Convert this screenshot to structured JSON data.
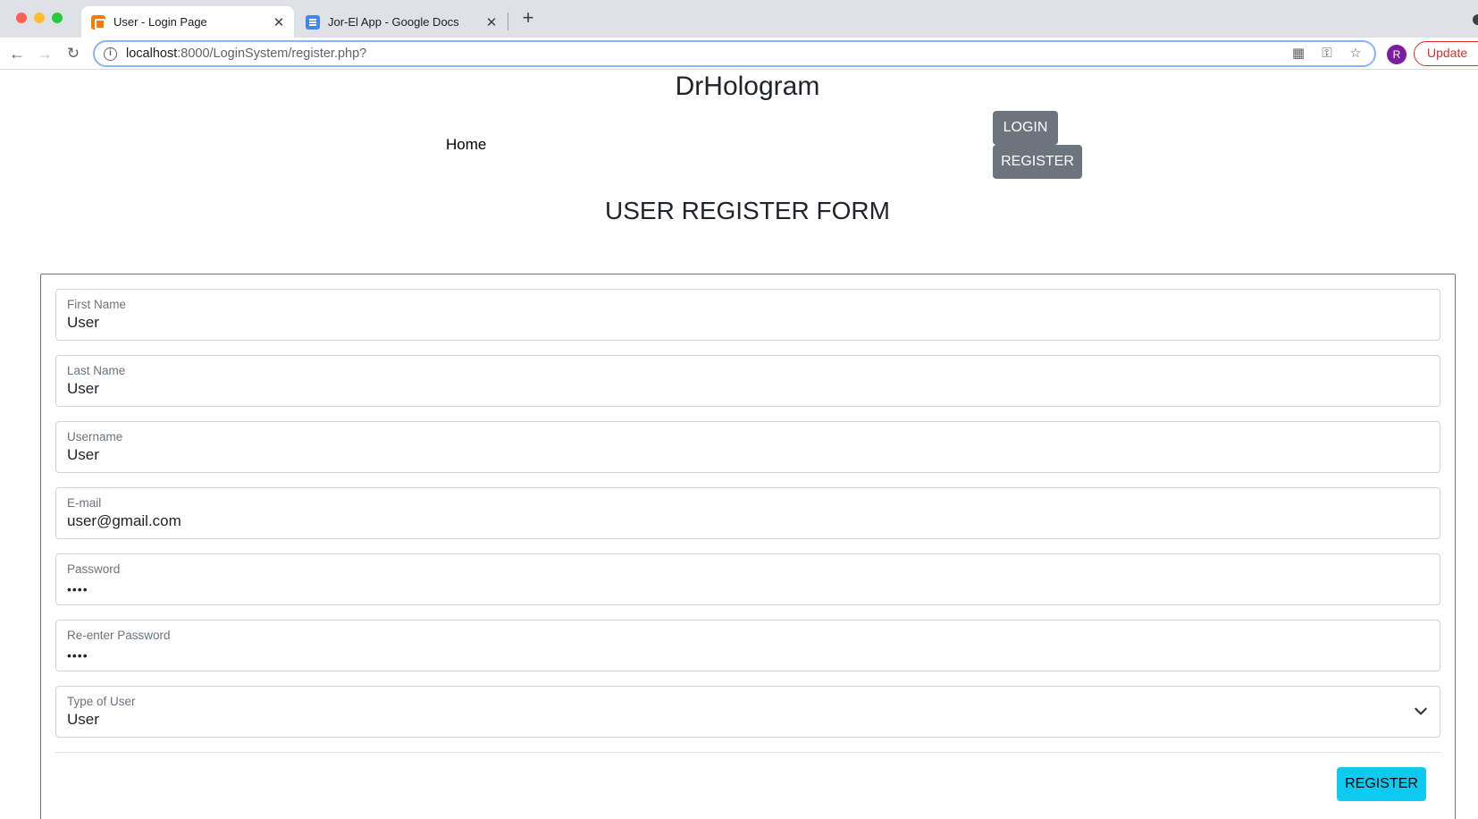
{
  "browser": {
    "tabs": [
      {
        "title": "User - Login Page",
        "icon": "xampp-favicon",
        "active": true
      },
      {
        "title": "Jor-El App - Google Docs",
        "icon": "google-docs-favicon",
        "active": false
      }
    ],
    "url_host": "localhost",
    "url_rest": ":8000/LoginSystem/register.php?",
    "profile_initial": "R",
    "update_label": "Update"
  },
  "header": {
    "site_title": "DrHologram",
    "nav_home": "Home",
    "login_button": "LOGIN",
    "register_button": "REGISTER"
  },
  "form": {
    "title": "USER REGISTER FORM",
    "fields": [
      {
        "label": "First Name",
        "value": "User"
      },
      {
        "label": "Last Name",
        "value": "User"
      },
      {
        "label": "Username",
        "value": "User"
      },
      {
        "label": "E-mail",
        "value": "user@gmail.com"
      },
      {
        "label": "Password",
        "value": "••••"
      },
      {
        "label": "Re-enter Password",
        "value": "••••"
      },
      {
        "label": "Type of User",
        "value": "User"
      }
    ],
    "submit_label": "REGISTER"
  },
  "colors": {
    "nav_button": "#6c757d",
    "submit_button": "#0dcaf0",
    "update_button": "#d93025",
    "profile": "#7b1fa2"
  }
}
